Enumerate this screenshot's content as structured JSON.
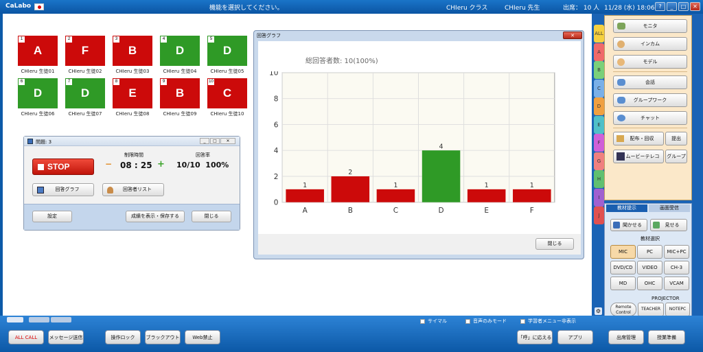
{
  "app": {
    "name": "CaLabo",
    "status": "機能を選択してください。",
    "class_label": "CHIeru クラス",
    "teacher": "CHIeru 先生",
    "attendance_label": "出席： 10 人",
    "datetime": "11/28 (水) 18:06"
  },
  "tiles": [
    {
      "num": "1",
      "letter": "A",
      "name": "CHIeru 生徒01",
      "color": "red"
    },
    {
      "num": "2",
      "letter": "F",
      "name": "CHIeru 生徒02",
      "color": "red"
    },
    {
      "num": "3",
      "letter": "B",
      "name": "CHIeru 生徒03",
      "color": "red"
    },
    {
      "num": "4",
      "letter": "D",
      "name": "CHIeru 生徒04",
      "color": "green"
    },
    {
      "num": "5",
      "letter": "D",
      "name": "CHIeru 生徒05",
      "color": "green"
    },
    {
      "num": "6",
      "letter": "D",
      "name": "CHIeru 生徒06",
      "color": "green"
    },
    {
      "num": "7",
      "letter": "D",
      "name": "CHIeru 生徒07",
      "color": "green"
    },
    {
      "num": "8",
      "letter": "E",
      "name": "CHIeru 生徒08",
      "color": "red"
    },
    {
      "num": "9",
      "letter": "B",
      "name": "CHIeru 生徒09",
      "color": "red"
    },
    {
      "num": "10",
      "letter": "C",
      "name": "CHIeru 生徒10",
      "color": "red"
    }
  ],
  "question": {
    "title": "問題: 3",
    "stop": "STOP",
    "time_label": "制限時間",
    "time": "08 : 25",
    "rate_label": "回答率",
    "rate": "10/10  100%",
    "graph_btn": "回答グラフ",
    "list_btn": "回答者リスト",
    "settings": "設定",
    "save_btn": "成績を表示・保存する",
    "close": "閉じる",
    "minus": "−",
    "plus": "+"
  },
  "graph": {
    "title": "回答グラフ",
    "total": "総回答者数: 10(100%)",
    "close": "閉じる"
  },
  "chart_data": {
    "type": "bar",
    "categories": [
      "A",
      "B",
      "C",
      "D",
      "E",
      "F"
    ],
    "values": [
      1,
      2,
      1,
      4,
      1,
      1
    ],
    "colors": [
      "#cc0a0a",
      "#cc0a0a",
      "#cc0a0a",
      "#2f9a26",
      "#cc0a0a",
      "#cc0a0a"
    ],
    "ylim": [
      0,
      10
    ],
    "yticks": [
      "0",
      "2",
      "4",
      "6",
      "8",
      "10"
    ],
    "grid": true
  },
  "tabs": [
    "ALL",
    "A",
    "B",
    "C",
    "D",
    "E",
    "F",
    "G",
    "H",
    "I",
    "J"
  ],
  "right": {
    "monitor": "モニタ",
    "intercom": "インカム",
    "model": "モデル",
    "talk": "会話",
    "groupwork": "グループワーク",
    "chat": "チャット",
    "distribute": "配布・回収",
    "submit": "提出",
    "movie": "ムービーテレコ",
    "group": "グループ",
    "tab1": "教材提示",
    "tab2": "画面受信",
    "listen": "聞かせる",
    "show": "見せる",
    "material": "教材選択",
    "src": [
      "MIC",
      "PC",
      "MIC+PC",
      "DVD/CD",
      "VIDEO",
      "CH-3",
      "MD",
      "OHC",
      "VCAM"
    ],
    "projector": "PROJECTOR",
    "remote": "Remote Control",
    "teacher": "TEACHER",
    "notepc": "NOTEPC"
  },
  "bottom": {
    "simul": "サイマル",
    "audio_only": "音声のみモード",
    "hide_menu": "学習者メニュー非表示",
    "allcall": "ALL CALL",
    "message": "メッセージ送信",
    "lock": "操作ロック",
    "blackout": "ブラックアウト",
    "web": "Web禁止",
    "respond": "「呼」に応える",
    "app": "アプリ",
    "attendance": "出席管理",
    "prep": "授業準備"
  }
}
